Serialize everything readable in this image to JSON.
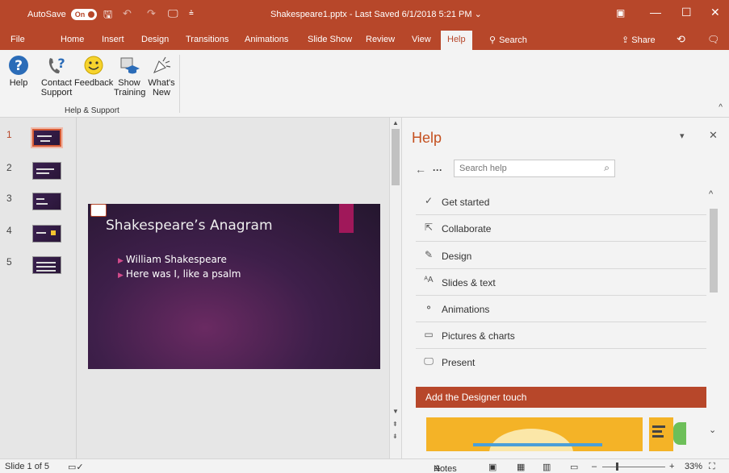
{
  "titlebar": {
    "autosave_label": "AutoSave",
    "autosave_state": "On",
    "title": "Shakespeare1.pptx  -  Last Saved 6/1/2018 5:21 PM",
    "title_caret": "⌄",
    "qa_save": "🖫",
    "qa_undo": "↶",
    "qa_redo": "↷",
    "qa_present": "🖵",
    "qa_more": "⩮",
    "win_restore_ribbon": "▣",
    "win_minimize": "—",
    "win_maximize": "☐",
    "win_close": "✕"
  },
  "tabs": [
    "File",
    "Home",
    "Insert",
    "Design",
    "Transitions",
    "Animations",
    "Slide Show",
    "Review",
    "View",
    "Help",
    "Search"
  ],
  "tabs_right": {
    "share": "Share",
    "history_icon": "⟲",
    "comments_icon": "🗨"
  },
  "ribbon": {
    "buttons": [
      {
        "label": "Help",
        "icon": "help-icon"
      },
      {
        "label": "Contact Support",
        "icon": "contact-support-icon"
      },
      {
        "label": "Feedback",
        "icon": "feedback-icon"
      },
      {
        "label": "Show Training",
        "icon": "training-icon"
      },
      {
        "label": "What's New",
        "icon": "whats-new-icon"
      }
    ],
    "btn_help_1": "Help",
    "btn_contact_1": "Contact",
    "btn_contact_2": "Support",
    "btn_feedback_1": "Feedback",
    "btn_training_1": "Show",
    "btn_training_2": "Training",
    "btn_whatsnew_1": "What's",
    "btn_whatsnew_2": "New",
    "group": "Help & Support",
    "collapse": "^"
  },
  "thumbnails": [
    "1",
    "2",
    "3",
    "4",
    "5"
  ],
  "slide": {
    "title": "Shakespeare’s Anagram",
    "bullets": [
      "William Shakespeare",
      "Here was I, like a psalm"
    ],
    "bullet_marker": "▶"
  },
  "help": {
    "title": "Help",
    "dropdown": "▾",
    "close": "✕",
    "back": "←",
    "more": "···",
    "search_placeholder": "Search help",
    "search_icon": "⌕",
    "items": [
      {
        "label": "Get started",
        "icon": "✓"
      },
      {
        "label": "Collaborate",
        "icon": "⇱"
      },
      {
        "label": "Design",
        "icon": "✎"
      },
      {
        "label": "Slides & text",
        "icon": "ᴬA"
      },
      {
        "label": "Animations",
        "icon": "⚬"
      },
      {
        "label": "Pictures & charts",
        "icon": "▭"
      },
      {
        "label": "Present",
        "icon": "🖵"
      }
    ],
    "designer_banner": "Add the Designer touch",
    "scroll_up": "^",
    "scroll_down": "⌄"
  },
  "status": {
    "slide_count": "Slide 1 of 5",
    "notes": "Notes",
    "notes_icon": "≙",
    "zoom_minus": "–",
    "zoom_plus": "+",
    "zoom_level": "33%",
    "fit_icon": "⛶"
  },
  "colors": {
    "accent": "#b7472a",
    "help_title": "#c4501f",
    "slide_accent": "#a0185a"
  }
}
